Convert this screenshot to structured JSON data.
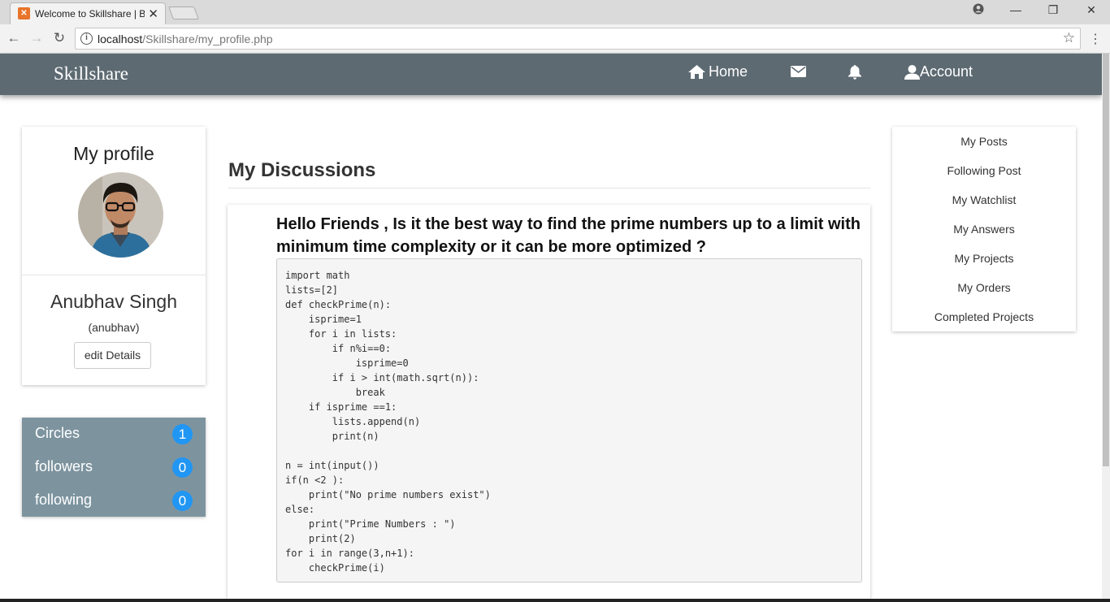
{
  "browser": {
    "tab_title": "Welcome to Skillshare | B",
    "url_host": "localhost",
    "url_path": "/Skillshare/my_profile.php"
  },
  "navbar": {
    "brand": "Skillshare",
    "home_label": "Home",
    "account_label": "Account"
  },
  "profile": {
    "heading": "My profile",
    "name": "Anubhav Singh",
    "username": "(anubhav)",
    "edit_label": "edit Details"
  },
  "stats": [
    {
      "label": "Circles",
      "count": "1"
    },
    {
      "label": "followers",
      "count": "0"
    },
    {
      "label": "following",
      "count": "0"
    }
  ],
  "discussions": {
    "title": "My Discussions",
    "question": "Hello Friends , Is it the best way to find the prime numbers up to a limit with minimum time complexity or it can be more optimized ?",
    "code": "import math\nlists=[2]\ndef checkPrime(n):\n    isprime=1\n    for i in lists:\n        if n%i==0:\n            isprime=0\n        if i > int(math.sqrt(n)):\n            break\n    if isprime ==1:\n        lists.append(n)\n        print(n)\n\nn = int(input())\nif(n <2 ):\n    print(\"No prime numbers exist\")\nelse:\n    print(\"Prime Numbers : \")\n    print(2)\nfor i in range(3,n+1):\n    checkPrime(i)"
  },
  "side_menu": [
    "My Posts",
    "Following Post",
    "My Watchlist",
    "My Answers",
    "My Projects",
    "My Orders",
    "Completed Projects"
  ],
  "colors": {
    "navbar": "#5d6a72",
    "stats_panel": "#7d949f",
    "badge": "#2196f3"
  }
}
